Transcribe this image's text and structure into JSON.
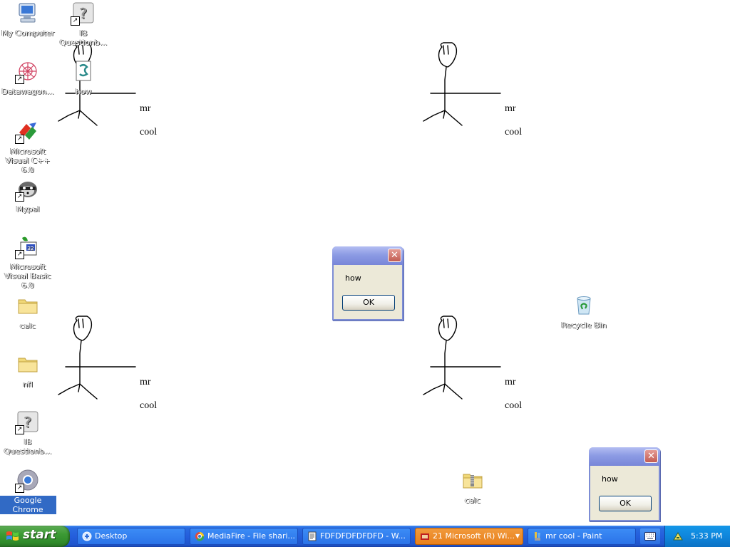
{
  "desktop": {
    "icons": [
      {
        "label": "My Computer",
        "icon": "my-computer-icon"
      },
      {
        "label": "IB Questionb...",
        "icon": "ib-question-icon"
      },
      {
        "label": "how",
        "icon": "script-file-icon"
      },
      {
        "label": "Datawagon...",
        "icon": "datawagon-icon"
      },
      {
        "label": "Microsoft Visual C++ 6.0",
        "icon": "visual-cpp-icon"
      },
      {
        "label": "Mypal",
        "icon": "mypal-icon"
      },
      {
        "label": "Microsoft Visual Basic 6.0",
        "icon": "visual-basic-icon"
      },
      {
        "label": "calc",
        "icon": "folder-icon"
      },
      {
        "label": "nfl",
        "icon": "folder-icon"
      },
      {
        "label": "IB Questionb...",
        "icon": "ib-question-icon"
      },
      {
        "label": "Google Chrome",
        "icon": "chrome-icon"
      },
      {
        "label": "Recycle Bin",
        "icon": "recycle-bin-icon"
      },
      {
        "label": "calc",
        "icon": "zip-folder-icon"
      }
    ],
    "figures": [
      {
        "line1": "mr",
        "line2": "cool"
      },
      {
        "line1": "mr",
        "line2": "cool"
      },
      {
        "line1": "mr",
        "line2": "cool"
      },
      {
        "line1": "mr",
        "line2": "cool"
      }
    ],
    "dialogs": [
      {
        "message": "how",
        "ok_label": "OK",
        "close_glyph": "✕"
      },
      {
        "message": "how",
        "ok_label": "OK",
        "close_glyph": "✕"
      }
    ]
  },
  "taskbar": {
    "start_label": "start",
    "tasks": [
      {
        "label": "Desktop",
        "icon": "desktop-icon",
        "active": false
      },
      {
        "label": "MediaFire - File shari...",
        "icon": "chrome-icon",
        "active": false
      },
      {
        "label": "FDFDFDFDFDFD - W...",
        "icon": "notepad-icon",
        "active": false
      },
      {
        "label": "21 Microsoft (R) Wi...",
        "icon": "vb-group-icon",
        "active": true
      },
      {
        "label": "mr cool - Paint",
        "icon": "paint-icon",
        "active": false
      }
    ],
    "clock": "5:33 PM"
  },
  "colors": {
    "taskbar_blue": "#245edc",
    "start_green": "#3c9a34",
    "active_task_orange": "#e8801c",
    "dialog_face": "#ece9d8"
  }
}
